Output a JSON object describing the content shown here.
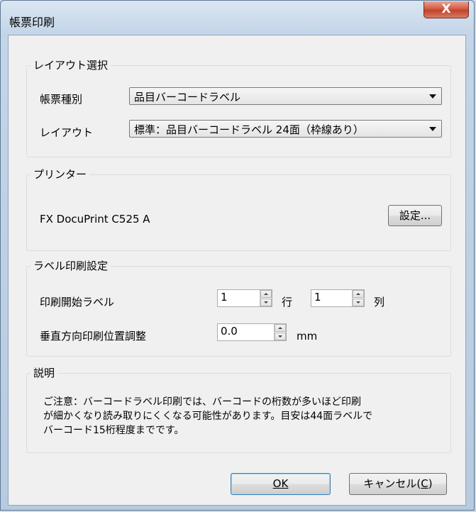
{
  "window": {
    "title": "帳票印刷",
    "close_label": "X"
  },
  "layout_group": {
    "legend": "レイアウト選択",
    "form_type_label": "帳票種別",
    "form_type_value": "品目バーコードラベル",
    "layout_label": "レイアウト",
    "layout_value": "標準：品目バーコードラベル 24面（枠線あり）"
  },
  "printer_group": {
    "legend": "プリンター",
    "printer_name": "FX DocuPrint C525 A",
    "settings_button": "設定..."
  },
  "label_group": {
    "legend": "ラベル印刷設定",
    "start_label": "印刷開始ラベル",
    "row_value": "1",
    "row_unit": "行",
    "col_value": "1",
    "col_unit": "列",
    "vertical_adjust_label": "垂直方向印刷位置調整",
    "vertical_adjust_value": "0.0",
    "vertical_adjust_unit": "mm"
  },
  "description_group": {
    "legend": "説明",
    "lines": [
      "ご注意：バーコードラベル印刷では、バーコードの桁数が多いほど印刷",
      "が細かくなり読み取りにくくなる可能性があります。目安は44面ラベルで",
      "バーコード15桁程度までです。"
    ]
  },
  "buttons": {
    "ok_label": "OK",
    "cancel_label": "キャンセル(",
    "cancel_accel": "C",
    "cancel_tail": ")"
  }
}
